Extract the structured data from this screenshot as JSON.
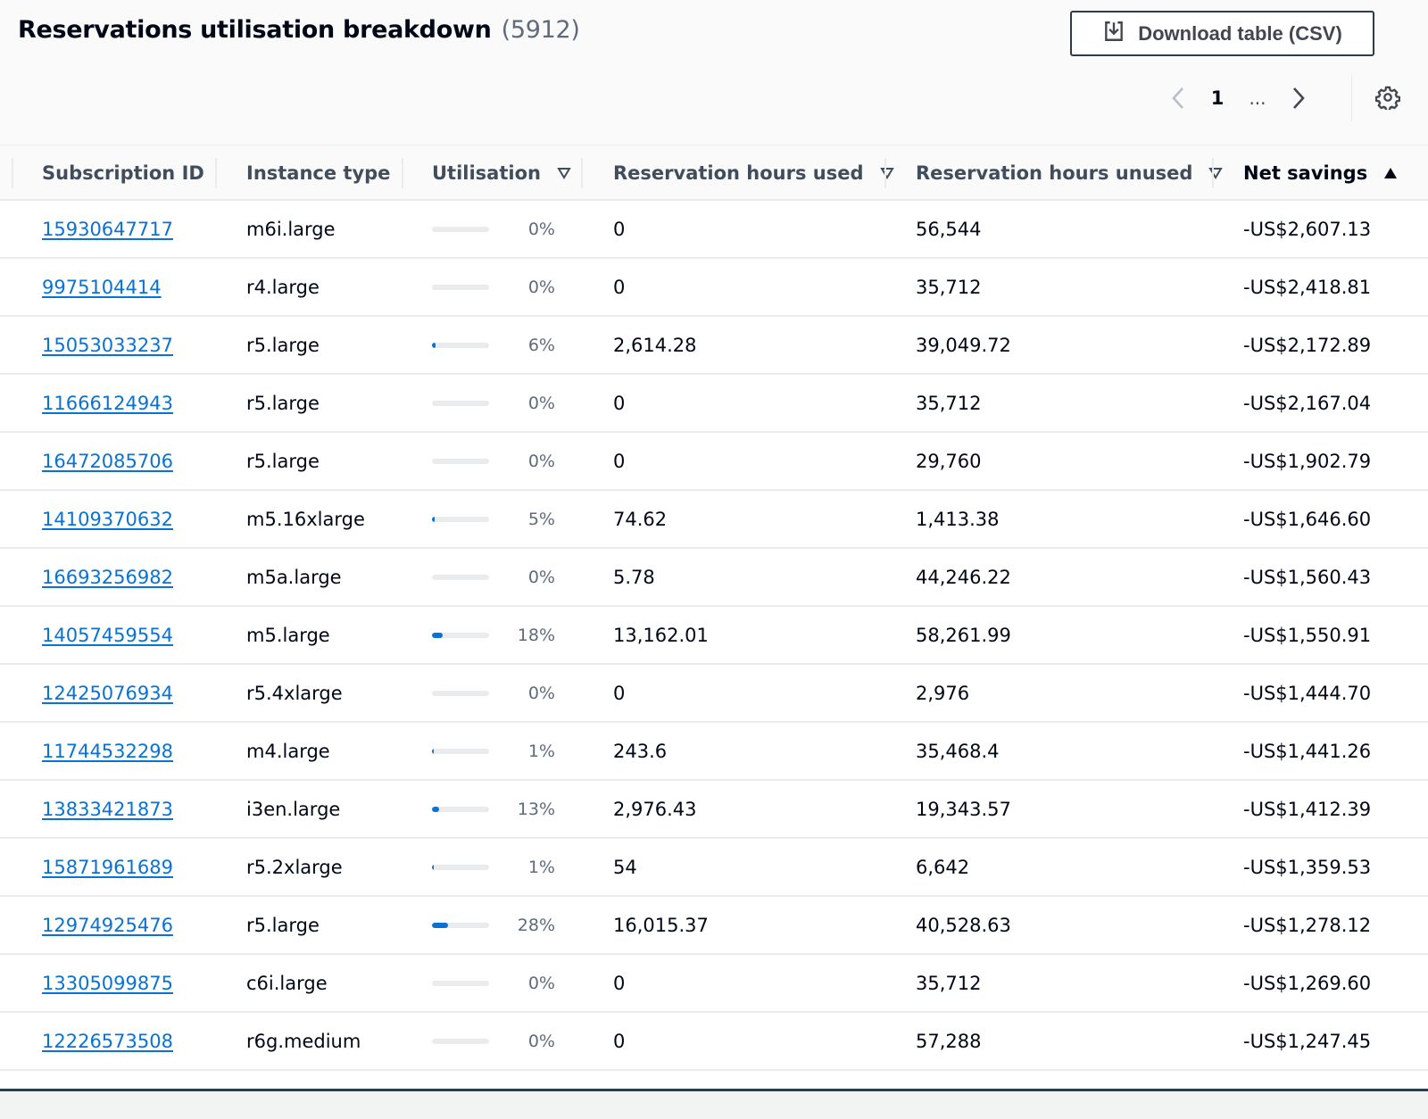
{
  "header": {
    "title": "Reservations utilisation breakdown",
    "count": "(5912)",
    "download_label": "Download table (CSV)"
  },
  "pagination": {
    "current_page": "1",
    "ellipsis": "...",
    "prev_icon": "chevron-left-icon",
    "next_icon": "chevron-right-icon",
    "prev_disabled": true
  },
  "settings_icon": "gear-icon",
  "colors": {
    "link": "#0972d3",
    "progress_fill": "#0972d3",
    "progress_track": "#e9ebed",
    "header_text": "#414d5c",
    "text": "#000716"
  },
  "table": {
    "columns": [
      {
        "label": "Subscription ID",
        "sort": "none"
      },
      {
        "label": "Instance type",
        "sort": "none"
      },
      {
        "label": "Utilisation",
        "sort": "sortable"
      },
      {
        "label": "Reservation hours used",
        "sort": "sortable"
      },
      {
        "label": "Reservation hours unused",
        "sort": "sortable"
      },
      {
        "label": "Net savings",
        "sort": "ascending"
      }
    ],
    "rows": [
      {
        "subscription_id": "15930647717",
        "instance_type": "m6i.large",
        "utilisation_pct": 0,
        "utilisation_label": "0%",
        "hours_used": "0",
        "hours_unused": "56,544",
        "net_savings": "-US$2,607.13"
      },
      {
        "subscription_id": "9975104414",
        "instance_type": "r4.large",
        "utilisation_pct": 0,
        "utilisation_label": "0%",
        "hours_used": "0",
        "hours_unused": "35,712",
        "net_savings": "-US$2,418.81"
      },
      {
        "subscription_id": "15053033237",
        "instance_type": "r5.large",
        "utilisation_pct": 6,
        "utilisation_label": "6%",
        "hours_used": "2,614.28",
        "hours_unused": "39,049.72",
        "net_savings": "-US$2,172.89"
      },
      {
        "subscription_id": "11666124943",
        "instance_type": "r5.large",
        "utilisation_pct": 0,
        "utilisation_label": "0%",
        "hours_used": "0",
        "hours_unused": "35,712",
        "net_savings": "-US$2,167.04"
      },
      {
        "subscription_id": "16472085706",
        "instance_type": "r5.large",
        "utilisation_pct": 0,
        "utilisation_label": "0%",
        "hours_used": "0",
        "hours_unused": "29,760",
        "net_savings": "-US$1,902.79"
      },
      {
        "subscription_id": "14109370632",
        "instance_type": "m5.16xlarge",
        "utilisation_pct": 5,
        "utilisation_label": "5%",
        "hours_used": "74.62",
        "hours_unused": "1,413.38",
        "net_savings": "-US$1,646.60"
      },
      {
        "subscription_id": "16693256982",
        "instance_type": "m5a.large",
        "utilisation_pct": 0,
        "utilisation_label": "0%",
        "hours_used": "5.78",
        "hours_unused": "44,246.22",
        "net_savings": "-US$1,560.43"
      },
      {
        "subscription_id": "14057459554",
        "instance_type": "m5.large",
        "utilisation_pct": 18,
        "utilisation_label": "18%",
        "hours_used": "13,162.01",
        "hours_unused": "58,261.99",
        "net_savings": "-US$1,550.91"
      },
      {
        "subscription_id": "12425076934",
        "instance_type": "r5.4xlarge",
        "utilisation_pct": 0,
        "utilisation_label": "0%",
        "hours_used": "0",
        "hours_unused": "2,976",
        "net_savings": "-US$1,444.70"
      },
      {
        "subscription_id": "11744532298",
        "instance_type": "m4.large",
        "utilisation_pct": 1,
        "utilisation_label": "1%",
        "hours_used": "243.6",
        "hours_unused": "35,468.4",
        "net_savings": "-US$1,441.26"
      },
      {
        "subscription_id": "13833421873",
        "instance_type": "i3en.large",
        "utilisation_pct": 13,
        "utilisation_label": "13%",
        "hours_used": "2,976.43",
        "hours_unused": "19,343.57",
        "net_savings": "-US$1,412.39"
      },
      {
        "subscription_id": "15871961689",
        "instance_type": "r5.2xlarge",
        "utilisation_pct": 1,
        "utilisation_label": "1%",
        "hours_used": "54",
        "hours_unused": "6,642",
        "net_savings": "-US$1,359.53"
      },
      {
        "subscription_id": "12974925476",
        "instance_type": "r5.large",
        "utilisation_pct": 28,
        "utilisation_label": "28%",
        "hours_used": "16,015.37",
        "hours_unused": "40,528.63",
        "net_savings": "-US$1,278.12"
      },
      {
        "subscription_id": "13305099875",
        "instance_type": "c6i.large",
        "utilisation_pct": 0,
        "utilisation_label": "0%",
        "hours_used": "0",
        "hours_unused": "35,712",
        "net_savings": "-US$1,269.60"
      },
      {
        "subscription_id": "12226573508",
        "instance_type": "r6g.medium",
        "utilisation_pct": 0,
        "utilisation_label": "0%",
        "hours_used": "0",
        "hours_unused": "57,288",
        "net_savings": "-US$1,247.45"
      }
    ]
  }
}
